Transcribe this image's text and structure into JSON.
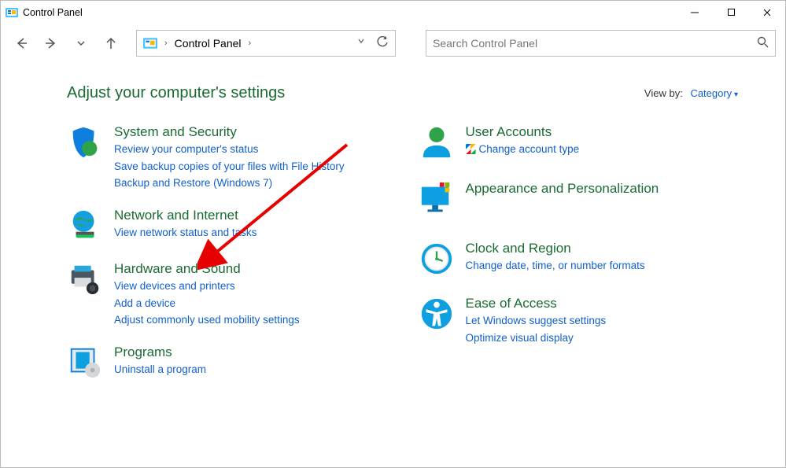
{
  "window": {
    "title": "Control Panel"
  },
  "address": {
    "crumb": "Control Panel"
  },
  "search": {
    "placeholder": "Search Control Panel"
  },
  "headline": "Adjust your computer's settings",
  "viewby": {
    "label": "View by:",
    "value": "Category"
  },
  "left": [
    {
      "title": "System and Security",
      "links": [
        "Review your computer's status",
        "Save backup copies of your files with File History",
        "Backup and Restore (Windows 7)"
      ]
    },
    {
      "title": "Network and Internet",
      "links": [
        "View network status and tasks"
      ]
    },
    {
      "title": "Hardware and Sound",
      "links": [
        "View devices and printers",
        "Add a device",
        "Adjust commonly used mobility settings"
      ]
    },
    {
      "title": "Programs",
      "links": [
        "Uninstall a program"
      ]
    }
  ],
  "right": [
    {
      "title": "User Accounts",
      "links": [
        "Change account type"
      ],
      "shield": [
        0
      ]
    },
    {
      "title": "Appearance and Personalization",
      "links": []
    },
    {
      "title": "Clock and Region",
      "links": [
        "Change date, time, or number formats"
      ]
    },
    {
      "title": "Ease of Access",
      "links": [
        "Let Windows suggest settings",
        "Optimize visual display"
      ]
    }
  ]
}
